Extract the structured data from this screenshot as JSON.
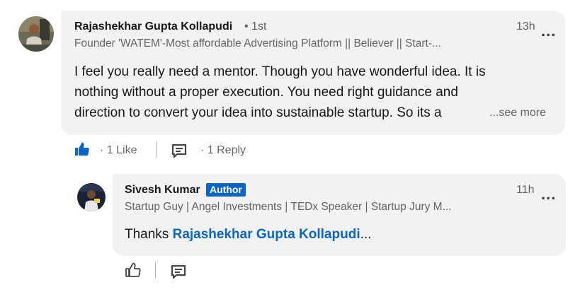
{
  "comment": {
    "author_name": "Rajashekhar Gupta Kollapudi",
    "degree": "• 1st",
    "headline": "Founder 'WATEM'-Most affordable Advertising Platform || Believer || Start-...",
    "time": "13h",
    "body_lines": [
      "I feel you really need a mentor. Though you have wonderful idea. It is",
      "nothing without a proper execution. You need right guidance and",
      "direction to convert your idea into sustainable startup. So its a"
    ],
    "see_more": "...see more",
    "actions": {
      "like_count": "· 1 Like",
      "reply_count": "· 1 Reply"
    }
  },
  "reply": {
    "author_name": "Sivesh Kumar",
    "badge": "Author",
    "headline": "Startup Guy | Angel Investments | TEDx Speaker | Startup Jury M...",
    "time": "11h",
    "text_prefix": "Thanks ",
    "mention": "Rajashekhar Gupta Kollapudi",
    "text_suffix": "..."
  },
  "icons": {
    "liked": "thumbs-up-filled-icon",
    "like": "thumbs-up-outline-icon",
    "reply": "comment-icon",
    "more": "ellipsis-icon"
  },
  "colors": {
    "accent": "#0a66c2",
    "bubble": "#f2f2f2",
    "muted_text": "#666666"
  }
}
